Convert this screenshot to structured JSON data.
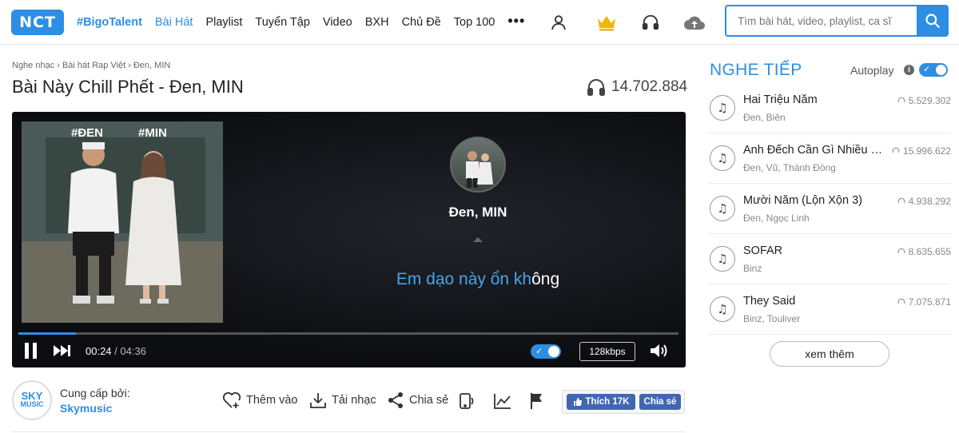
{
  "header": {
    "logo": "NCT",
    "nav": [
      "#BigoTalent",
      "Bài Hát",
      "Playlist",
      "Tuyển Tập",
      "Video",
      "BXH",
      "Chủ Đề",
      "Top 100"
    ],
    "more": "•••",
    "search_placeholder": "Tìm bài hát, video, playlist, ca sĩ"
  },
  "breadcrumb": [
    "Nghe nhạc",
    "›",
    "Bài hát Rap Việt",
    "›",
    "Đen, MIN"
  ],
  "song": {
    "title": "Bài Này Chill Phết - Đen, MIN",
    "listens": "14.702.884"
  },
  "player": {
    "cover_tags": [
      "#ĐEN",
      "#MIN"
    ],
    "artist": "Đen, MIN",
    "lyric_done": "Em dạo này ổn kh",
    "lyric_rest": "ông",
    "current_time": "00:24",
    "separator": "/",
    "duration": "04:36",
    "progress": 0.087,
    "toggle_check": "✓",
    "quality": "128kbps"
  },
  "provider": {
    "logo_line1": "SKY",
    "logo_line2": "MUSIC",
    "label": "Cung cấp bởi:",
    "name": "Skymusic"
  },
  "actions": {
    "add": "Thêm vào",
    "download": "Tải nhạc",
    "share": "Chia sẻ"
  },
  "facebook": {
    "like": "Thích 17K",
    "share": "Chia sẻ"
  },
  "up_next": {
    "title": "NGHE TIẾP",
    "autoplay_label": "Autoplay",
    "info": "i",
    "check": "✓",
    "note": "♫",
    "items": [
      {
        "title": "Hai Triệu Năm",
        "artists": "Đen, Biên",
        "count": "5.529.302"
      },
      {
        "title": "Anh Đếch Cần Gì Nhiều N...",
        "artists": "Đen, Vũ, Thành Đồng",
        "count": "15.996.622"
      },
      {
        "title": "Mười Năm (Lộn Xộn 3)",
        "artists": "Đen, Ngọc Linh",
        "count": "4.938.292"
      },
      {
        "title": "SOFAR",
        "artists": "Binz",
        "count": "8.635.655"
      },
      {
        "title": "They Said",
        "artists": "Binz, Touliver",
        "count": "7.075.871"
      }
    ],
    "more_button": "xem thêm"
  },
  "colors": {
    "accent": "#2d8ee3",
    "player_bg": "#0c0d10",
    "facebook": "#4267b2"
  }
}
